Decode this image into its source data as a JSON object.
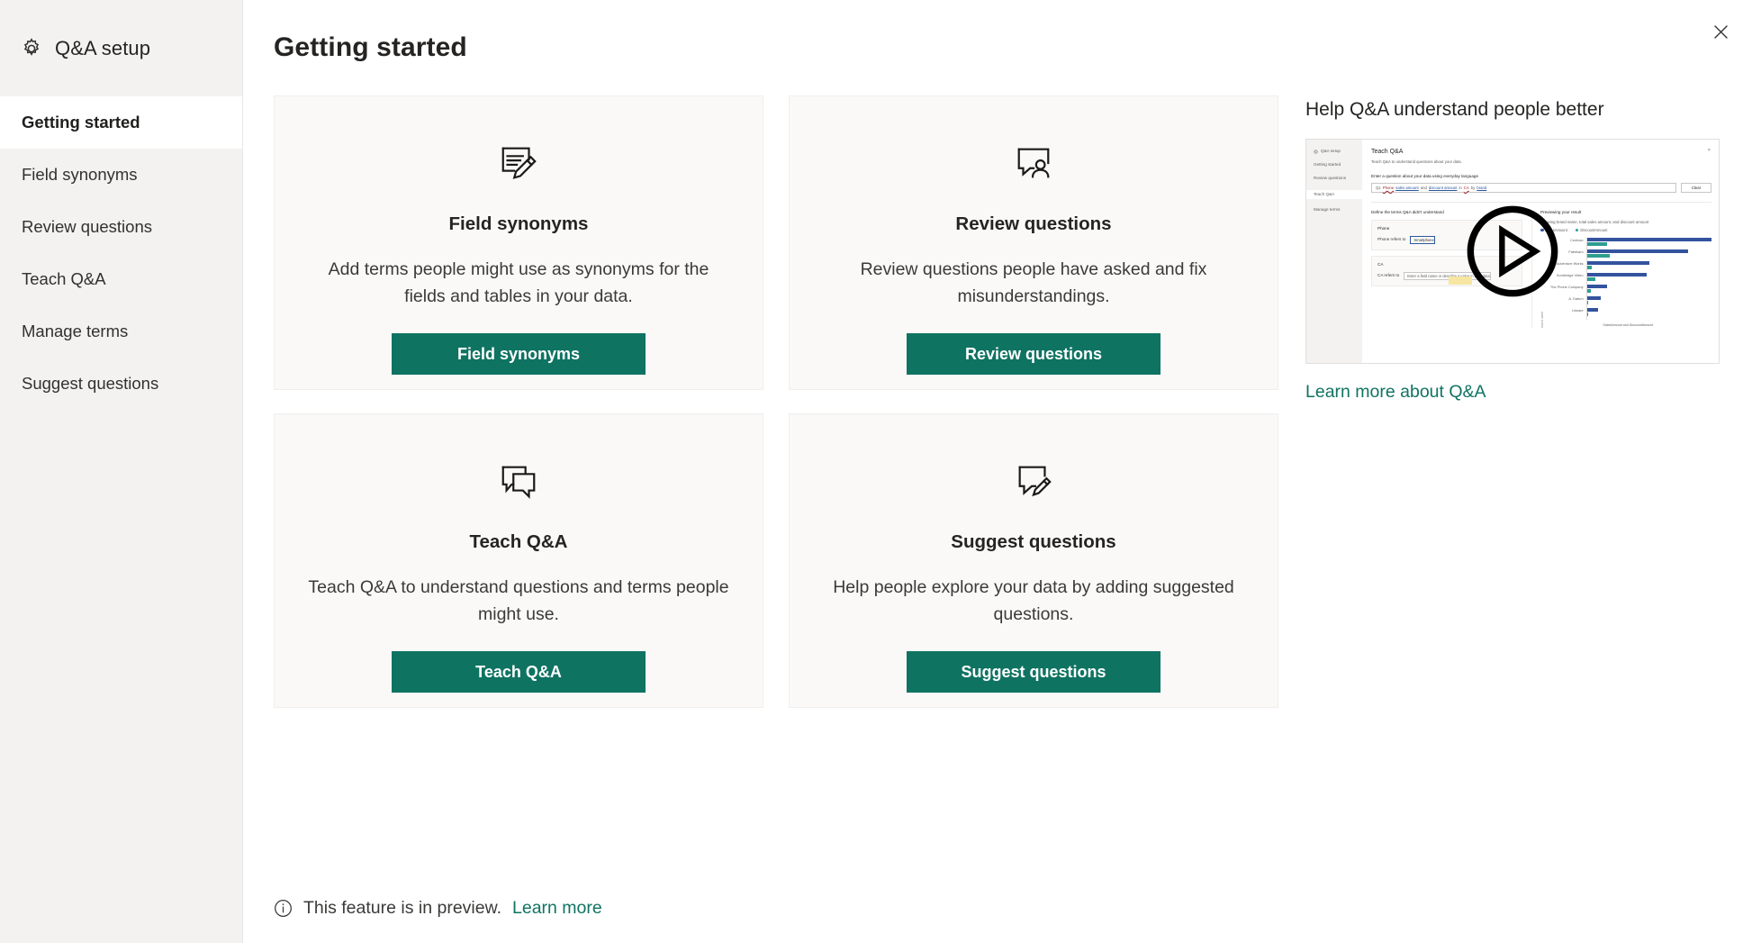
{
  "sidebar": {
    "icon": "gear-icon",
    "title": "Q&A setup",
    "items": [
      {
        "label": "Getting started",
        "selected": true
      },
      {
        "label": "Field synonyms",
        "selected": false
      },
      {
        "label": "Review questions",
        "selected": false
      },
      {
        "label": "Teach Q&A",
        "selected": false
      },
      {
        "label": "Manage terms",
        "selected": false
      },
      {
        "label": "Suggest questions",
        "selected": false
      }
    ]
  },
  "header": {
    "title": "Getting started",
    "close_icon": "close-icon"
  },
  "cards": [
    {
      "icon": "note-edit-icon",
      "title": "Field synonyms",
      "description": "Add terms people might use as synonyms for the fields and tables in your data.",
      "button_label": "Field synonyms"
    },
    {
      "icon": "comment-person-icon",
      "title": "Review questions",
      "description": "Review questions people have asked and fix misunderstandings.",
      "button_label": "Review questions"
    },
    {
      "icon": "double-comment-icon",
      "title": "Teach Q&A",
      "description": "Teach Q&A to understand questions and terms people might use.",
      "button_label": "Teach Q&A"
    },
    {
      "icon": "comment-edit-icon",
      "title": "Suggest questions",
      "description": "Help people explore your data by adding suggested questions.",
      "button_label": "Suggest questions"
    }
  ],
  "help": {
    "title": "Help Q&A understand people better",
    "play_icon": "play-icon",
    "link_label": "Learn more about Q&A",
    "thumbnail": {
      "side_title": "Q&A setup",
      "side_items": [
        "Getting started",
        "Review questions",
        "Teach Q&A",
        "Manage terms"
      ],
      "selected_side_item": "Teach Q&A",
      "heading": "Teach Q&A",
      "subheading": "Teach Q&A to understand questions about your data.",
      "prompt_label": "Enter a question about your data using everyday language",
      "query_prefix": "Q1",
      "query_red": "Phone",
      "query_link_1": "sales amount",
      "query_mid": "and",
      "query_link_2": "discount amount",
      "query_tail": "in",
      "query_red_2": "CA",
      "query_by": "by",
      "query_link_3": "brand",
      "clear_button": "Clear",
      "define_label": "Define the terms Q&A didn't understand",
      "term_box_title": "Phone",
      "term_refers_label": "Phone refers to",
      "term_value": "Smartphone",
      "term_box_title_2": "CA",
      "term_refers_label_2": "CA refers to",
      "term_placeholder": "Enter a field name or describe a value in your data",
      "result_title": "Previewing your result",
      "result_sub": "Showing brand name, total sales amount, and discount amount",
      "legend": [
        {
          "name": "SalesAmount",
          "color": "#33539e"
        },
        {
          "name": "DiscountAmount",
          "color": "#2e9e8f"
        }
      ],
      "y_axis_label": "brand name",
      "x_axis_label": "SalesAmount and DiscountAmount",
      "close_glyph": "×"
    }
  },
  "footer": {
    "info_icon": "info-circle-icon",
    "text": "This feature is in preview.",
    "link_label": "Learn more"
  },
  "chart_data": {
    "type": "bar",
    "title": "Previewing your result",
    "subtitle": "Showing brand name, total sales amount, and discount amount",
    "orientation": "horizontal",
    "categories": [
      "Contoso",
      "Fabrikam",
      "Adventure Works",
      "Southridge Video",
      "The Phone Company",
      "A. Datum",
      "Litware"
    ],
    "series": [
      {
        "name": "SalesAmount",
        "color": "#33539e",
        "values": [
          100,
          81,
          50,
          48,
          16,
          11,
          9
        ]
      },
      {
        "name": "DiscountAmount",
        "color": "#2e9e8f",
        "values": [
          16,
          18,
          4,
          7,
          3,
          1,
          1
        ]
      }
    ],
    "xlabel": "SalesAmount and DiscountAmount",
    "ylabel": "brand name",
    "grid": false,
    "legend_position": "top"
  }
}
